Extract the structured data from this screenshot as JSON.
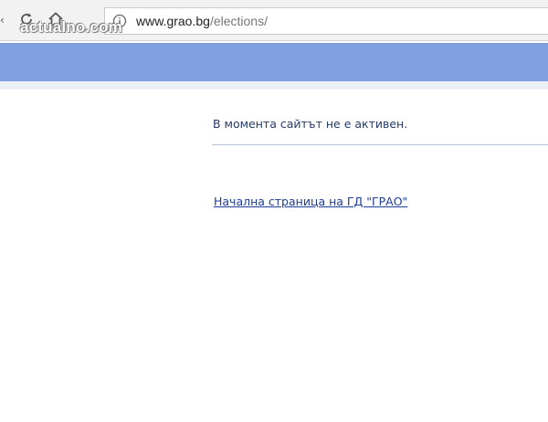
{
  "browser": {
    "url_host": "www.grao.bg",
    "url_path": "/elections/",
    "back_glyph": "‹"
  },
  "watermark": {
    "text": "actualno.com"
  },
  "page": {
    "message": "В момента сайтът не е активен.",
    "home_link": "Начална страница на ГД \"ГРАО\""
  },
  "icons": {
    "back": "back-arrow-icon",
    "reload": "reload-icon",
    "home": "home-icon",
    "info": "info-icon"
  },
  "colors": {
    "header_band": "#7f9fe0",
    "message_text": "#243a6a",
    "link": "#1f3d9a"
  }
}
